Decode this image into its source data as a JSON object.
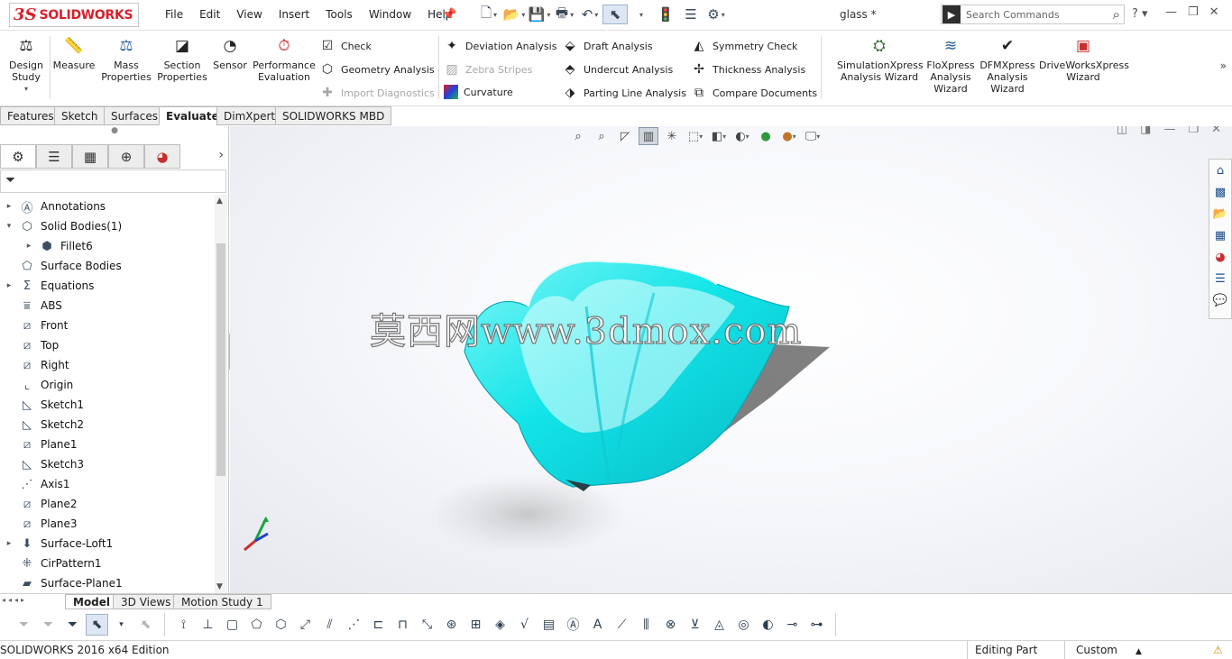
{
  "titlebar": {
    "logo_ds": "3S",
    "logo_name": "SOLIDWORKS",
    "menu": [
      "File",
      "Edit",
      "View",
      "Insert",
      "Tools",
      "Window",
      "Help"
    ],
    "doc_title": "glass *",
    "search_placeholder": "Search Commands",
    "help_label": "?"
  },
  "ribbon": {
    "design_study": "Design Study",
    "measure": "Measure",
    "mass_properties": "Mass Properties",
    "section_properties": "Section Properties",
    "sensor": "Sensor",
    "performance_evaluation": "Performance Evaluation",
    "check": "Check",
    "geometry_analysis": "Geometry Analysis",
    "import_diagnostics": "Import Diagnostics",
    "deviation_analysis": "Deviation Analysis",
    "zebra_stripes": "Zebra Stripes",
    "curvature": "Curvature",
    "draft_analysis": "Draft Analysis",
    "undercut_analysis": "Undercut Analysis",
    "parting_line_analysis": "Parting Line Analysis",
    "symmetry_check": "Symmetry Check",
    "thickness_analysis": "Thickness Analysis",
    "compare_documents": "Compare Documents",
    "simulationxpress": "SimulationXpress Analysis Wizard",
    "floxpress": "FloXpress Analysis Wizard",
    "dfmxpress": "DFMXpress Analysis Wizard",
    "driveworksxpress": "DriveWorksXpress Wizard"
  },
  "cm_tabs": [
    "Features",
    "Sketch",
    "Surfaces",
    "Evaluate",
    "DimXpert",
    "SOLIDWORKS MBD"
  ],
  "tree": [
    {
      "label": "Annotations",
      "expand": "▸",
      "icon": "annotations-icon"
    },
    {
      "label": "Solid Bodies(1)",
      "expand": "▾",
      "icon": "solid-bodies-icon"
    },
    {
      "label": "Fillet6",
      "expand": "▸",
      "icon": "body-icon"
    },
    {
      "label": "Surface Bodies",
      "expand": "",
      "icon": "surface-bodies-icon"
    },
    {
      "label": "Equations",
      "expand": "▸",
      "icon": "equations-icon"
    },
    {
      "label": "ABS",
      "expand": "",
      "icon": "material-icon"
    },
    {
      "label": "Front",
      "expand": "",
      "icon": "plane-icon"
    },
    {
      "label": "Top",
      "expand": "",
      "icon": "plane-icon"
    },
    {
      "label": "Right",
      "expand": "",
      "icon": "plane-icon"
    },
    {
      "label": "Origin",
      "expand": "",
      "icon": "origin-icon"
    },
    {
      "label": "Sketch1",
      "expand": "",
      "icon": "sketch-icon"
    },
    {
      "label": "Sketch2",
      "expand": "",
      "icon": "sketch-icon"
    },
    {
      "label": "Plane1",
      "expand": "",
      "icon": "plane-icon"
    },
    {
      "label": "Sketch3",
      "expand": "",
      "icon": "sketch-icon"
    },
    {
      "label": "Axis1",
      "expand": "",
      "icon": "axis-icon"
    },
    {
      "label": "Plane2",
      "expand": "",
      "icon": "plane-icon"
    },
    {
      "label": "Plane3",
      "expand": "",
      "icon": "plane-icon"
    },
    {
      "label": "Surface-Loft1",
      "expand": "▸",
      "icon": "loft-icon"
    },
    {
      "label": "CirPattern1",
      "expand": "",
      "icon": "pattern-icon"
    },
    {
      "label": "Surface-Plane1",
      "expand": "",
      "icon": "surface-plane-icon"
    }
  ],
  "viewport": {
    "watermark": "莫西网www.3dmox.com"
  },
  "bottom_tabs": [
    "Model",
    "3D Views",
    "Motion Study 1"
  ],
  "status": {
    "edition": "SOLIDWORKS 2016 x64 Edition",
    "mode": "Editing Part",
    "units": "Custom"
  },
  "colors": {
    "model": "#19e6ea",
    "brand": "#d8202a",
    "accent": "#2a6fd6"
  }
}
